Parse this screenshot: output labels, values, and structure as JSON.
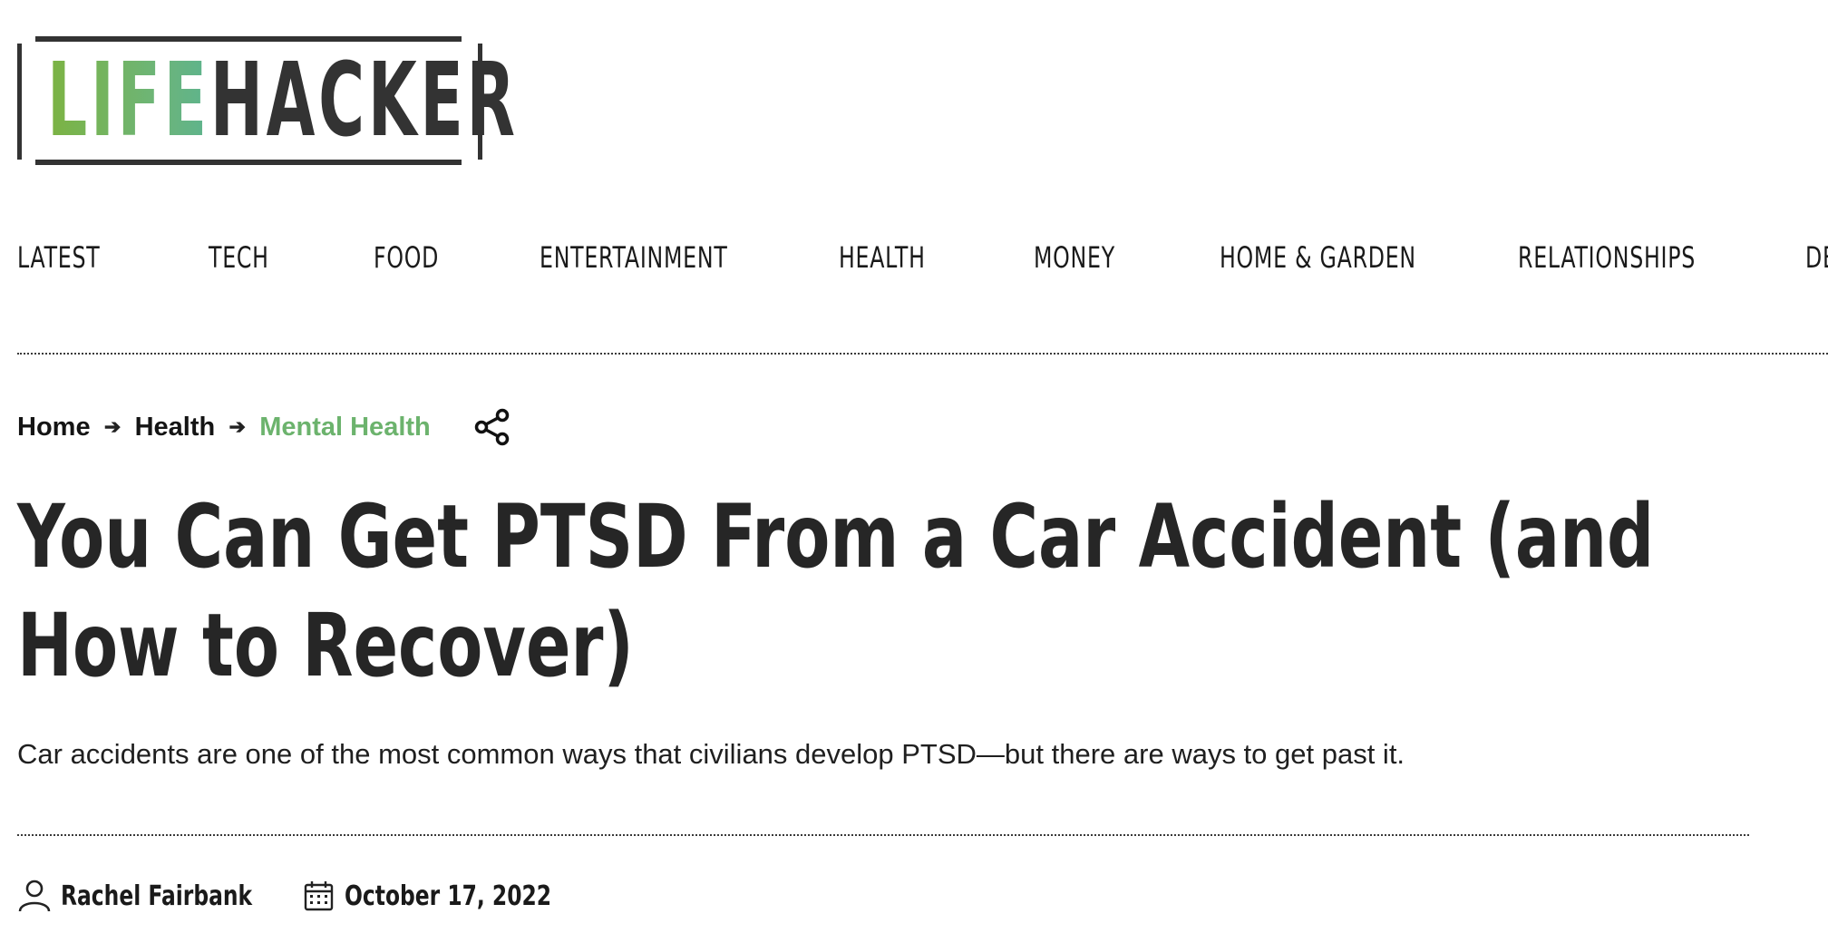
{
  "brand": {
    "logo_part_1": "LIFE",
    "logo_part_2": "HACKER",
    "accent_green": "#6cb36d",
    "text_dark": "#262626"
  },
  "nav": {
    "items": [
      {
        "label": "LATEST"
      },
      {
        "label": "TECH"
      },
      {
        "label": "FOOD"
      },
      {
        "label": "ENTERTAINMENT"
      },
      {
        "label": "HEALTH"
      },
      {
        "label": "MONEY"
      },
      {
        "label": "HOME & GARDEN"
      },
      {
        "label": "RELATIONSHIPS"
      },
      {
        "label": "DE"
      }
    ]
  },
  "breadcrumb": {
    "items": [
      {
        "label": "Home"
      },
      {
        "label": "Health"
      },
      {
        "label": "Mental Health"
      }
    ],
    "separator_icon": "arrow-right-icon",
    "share_icon": "share-icon"
  },
  "article": {
    "title": "You Can Get PTSD From a Car Accident (and How to Recover)",
    "dek": "Car accidents are one of the most common ways that civilians develop PTSD—but there are ways to get past it.",
    "author": "Rachel Fairbank",
    "author_icon": "person-icon",
    "date": "October 17, 2022",
    "date_icon": "calendar-icon"
  }
}
